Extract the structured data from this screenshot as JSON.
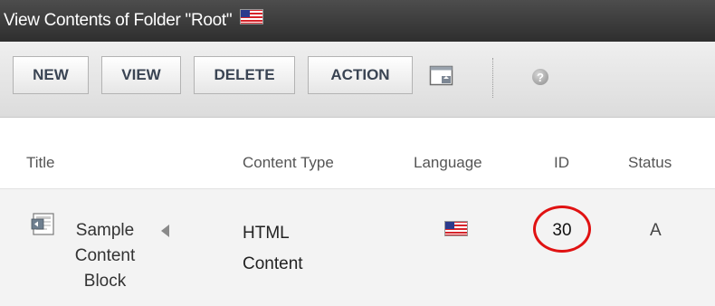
{
  "window": {
    "title": "View Contents of Folder \"Root\"",
    "flag_icon": "us-flag-icon"
  },
  "toolbar": {
    "new_label": "NEW",
    "view_label": "VIEW",
    "delete_label": "DELETE",
    "action_label": "ACTION",
    "export_icon": "export-window-icon",
    "help_icon": "help-icon",
    "help_glyph": "?"
  },
  "table": {
    "columns": [
      "Title",
      "Content Type",
      "Language",
      "ID",
      "Status"
    ],
    "rows": [
      {
        "title": "Sample Content Block",
        "content_type": "HTML Content",
        "language_icon": "us-flag-icon",
        "id": "30",
        "status": "A"
      }
    ]
  },
  "colors": {
    "titlebar_bg": "#3a3a3a",
    "button_text": "#3a4453",
    "highlight_circle": "#e01212",
    "row_bg": "#f3f3f3"
  }
}
